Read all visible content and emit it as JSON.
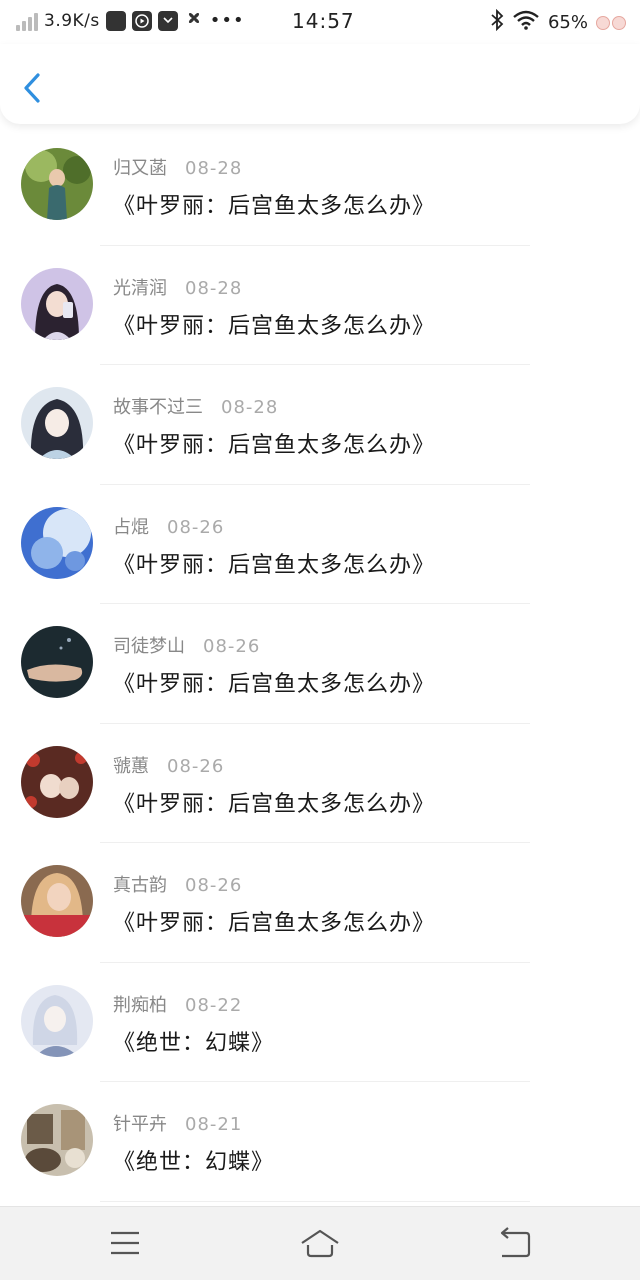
{
  "status_bar": {
    "speed": "3.9K/s",
    "time": "14:57",
    "battery": "65%",
    "icons": [
      "signal-icon",
      "app-notification-icon",
      "video-app-icon",
      "mail-app-icon",
      "fan-app-icon",
      "more-dots-icon",
      "bluetooth-icon",
      "wifi-icon"
    ]
  },
  "header": {
    "back_icon": "chevron-left-icon",
    "accent_color": "#2f8fdf"
  },
  "items": [
    {
      "name": "归又菡",
      "date": "08-28",
      "title": "《叶罗丽：后宫鱼太多怎么办》"
    },
    {
      "name": "光清润",
      "date": "08-28",
      "title": "《叶罗丽：后宫鱼太多怎么办》"
    },
    {
      "name": "故事不过三",
      "date": "08-28",
      "title": "《叶罗丽：后宫鱼太多怎么办》"
    },
    {
      "name": "占焜",
      "date": "08-26",
      "title": "《叶罗丽：后宫鱼太多怎么办》"
    },
    {
      "name": "司徒梦山",
      "date": "08-26",
      "title": "《叶罗丽：后宫鱼太多怎么办》"
    },
    {
      "name": "虢蕙",
      "date": "08-26",
      "title": "《叶罗丽：后宫鱼太多怎么办》"
    },
    {
      "name": "真古韵",
      "date": "08-26",
      "title": "《叶罗丽：后宫鱼太多怎么办》"
    },
    {
      "name": "荆痴柏",
      "date": "08-22",
      "title": "《绝世：幻蝶》"
    },
    {
      "name": "针平卉",
      "date": "08-21",
      "title": "《绝世：幻蝶》"
    }
  ],
  "nav_bar": {
    "icons": [
      "menu-icon",
      "home-icon",
      "back-icon"
    ]
  }
}
